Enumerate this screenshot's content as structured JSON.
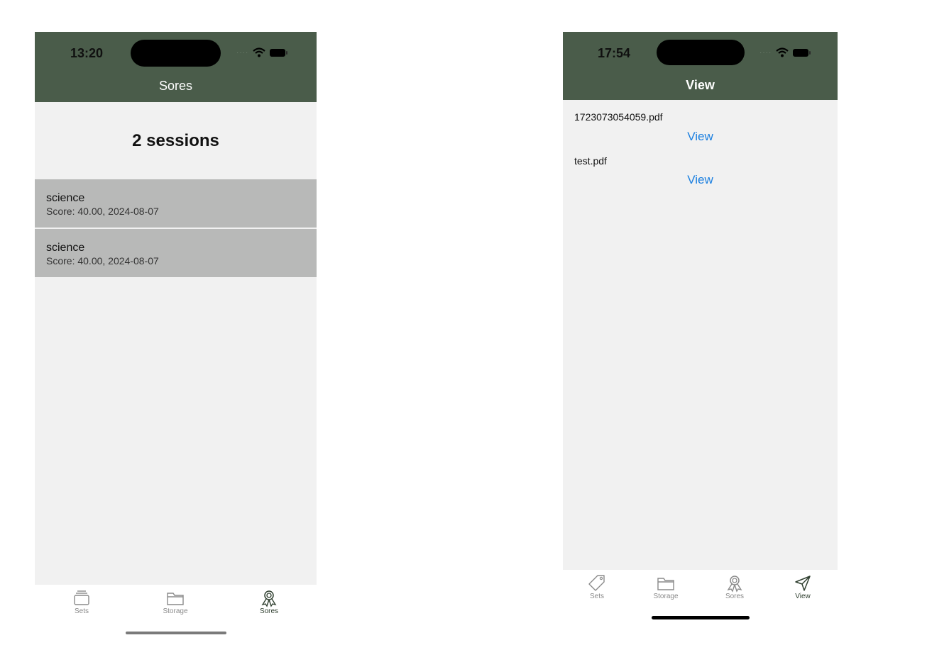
{
  "left": {
    "status_time": "13:20",
    "header_title": "Sores",
    "sessions_label": "2 sessions",
    "sessions": [
      {
        "title": "science",
        "subtitle": "Score: 40.00, 2024-08-07"
      },
      {
        "title": "science",
        "subtitle": "Score: 40.00, 2024-08-07"
      }
    ],
    "tabs": [
      {
        "label": "Sets",
        "icon": "stack-icon"
      },
      {
        "label": "Storage",
        "icon": "folder-icon"
      },
      {
        "label": "Sores",
        "icon": "ribbon-award-icon",
        "active": true
      }
    ]
  },
  "right": {
    "status_time": "17:54",
    "header_title": "View",
    "files": [
      {
        "name": "1723073054059.pdf",
        "action": "View"
      },
      {
        "name": "test.pdf",
        "action": "View"
      }
    ],
    "tabs": [
      {
        "label": "Sets",
        "icon": "tag-icon"
      },
      {
        "label": "Storage",
        "icon": "folder-icon"
      },
      {
        "label": "Sores",
        "icon": "ribbon-award-icon"
      },
      {
        "label": "View",
        "icon": "send-icon",
        "active": true
      }
    ]
  },
  "colors": {
    "header": "#4a5c4a",
    "content_bg": "#f1f1f1",
    "row_bg": "#b8b9b8",
    "link": "#1a7fe0",
    "tab_active": "#2f3f2f"
  }
}
